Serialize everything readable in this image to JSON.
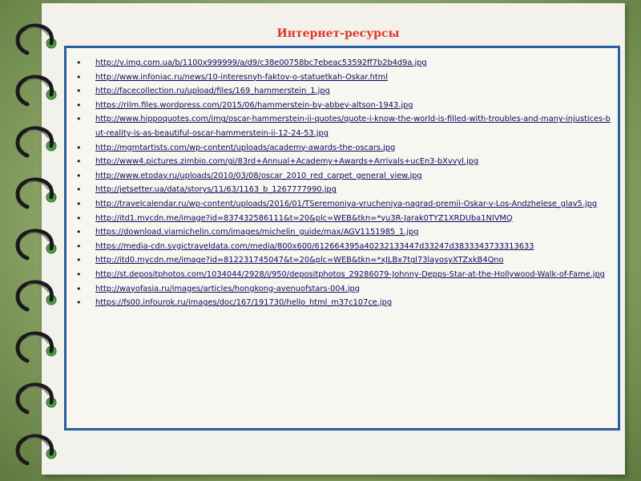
{
  "title": "Интернет-ресурсы",
  "links": [
    "http://v.img.com.ua/b/1100x999999/a/d9/c38e00758bc7ebeac53592ff7b2b4d9a.jpg",
    "http://www.infoniac.ru/news/10-interesnyh-faktov-o-statuetkah-Oskar.html",
    "http://facecollection.ru/upload/files/169_hammerstein_1.jpg",
    "https://rilm.files.wordpress.com/2015/06/hammerstein-by-abbey-altson-1943.jpg",
    "http://www.hippoquotes.com/img/oscar-hammerstein-ii-quotes/quote-i-know-the-world-is-filled-with-troubles-and-many-injustices-but-reality-is-as-beautiful-oscar-hammerstein-ii-12-24-53.jpg",
    "http://mgmtartists.com/wp-content/uploads/academy-awards-the-oscars.jpg",
    "http://www4.pictures.zimbio.com/gi/83rd+Annual+Academy+Awards+Arrivals+ucEn3-bXvvyl.jpg",
    "http://www.etoday.ru/uploads/2010/03/08/oscar_2010_red_carpet_general_view.jpg",
    "http://jetsetter.ua/data/storys/11/63/1163_b_1267777990.jpg",
    "http://travelcalendar.ru/wp-content/uploads/2016/01/TSeremoniya-vrucheniya-nagrad-premii-Oskar-v-Los-Andzhelese_glav5.jpg",
    "http://itd1.mycdn.me/image?id=837432586111&t=20&plc=WEB&tkn=*yu3R-Jarak0TYZ1XRDUba1NIVMQ",
    "https://download.viamichelin.com/images/michelin_guide/max/AGV1151985_1.jpg",
    "https://media-cdn.sygictraveldata.com/media/800x600/612664395a40232133447d33247d3833343733313633",
    "http://itd0.mycdn.me/image?id=812231745047&t=20&plc=WEB&tkn=*xJLBx7tgl73layosyXTZxkB4Qno",
    "http://st.depositphotos.com/1034044/2928/i/950/depositphotos_29286079-Johnny-Depps-Star-at-the-Hollywood-Walk-of-Fame.jpg",
    "http://wayofasia.ru/images/articles/hongkong-avenuofstars-004.jpg",
    "https://fs00.infourok.ru/images/doc/167/191730/hello_html_m37c107ce.jpg"
  ],
  "icons": {
    "binder_ring": "binder-ring-icon",
    "bullet": "bullet-icon"
  },
  "colors": {
    "title": "#e0382a",
    "border": "#2b5e9e",
    "link": "#0a0a5a",
    "ring": "#1a1a1a",
    "ring_hole": "#4fa14a"
  }
}
